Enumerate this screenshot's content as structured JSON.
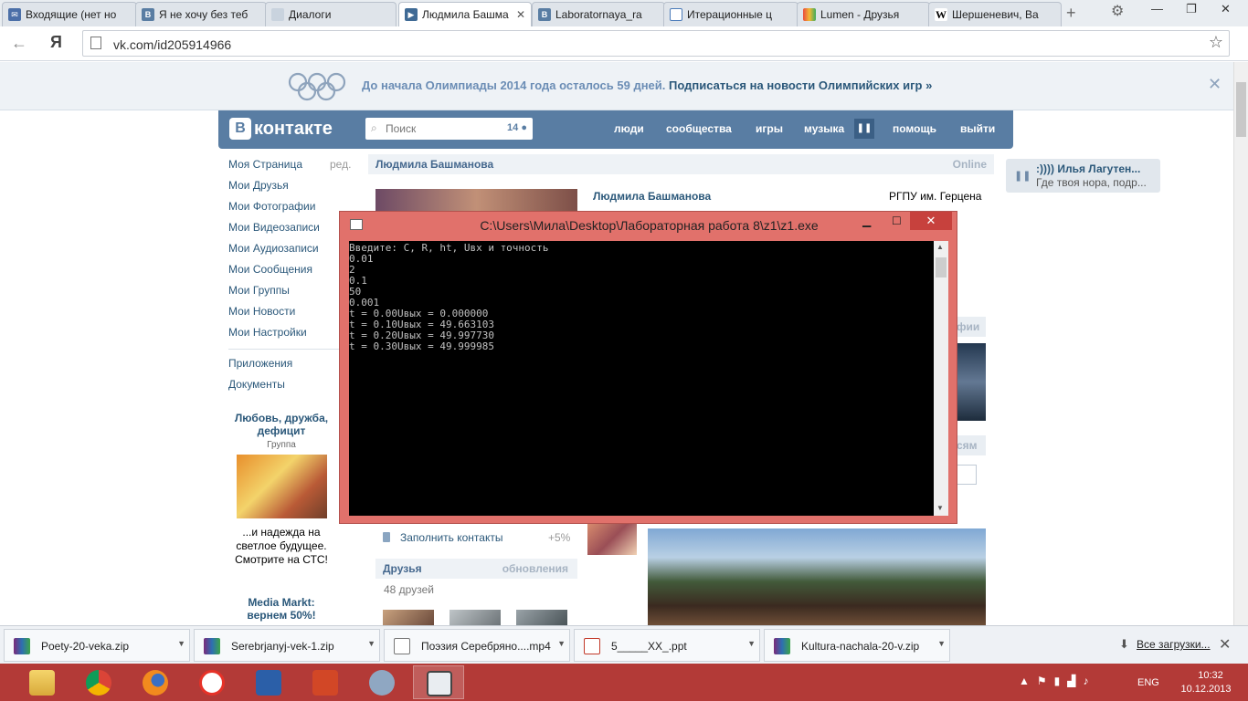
{
  "browser": {
    "tabs": [
      {
        "label": "Входящие (нет но",
        "fav": "mail"
      },
      {
        "label": "Я не хочу без теб",
        "fav": "vk"
      },
      {
        "label": "Диалоги",
        "fav": "doc"
      },
      {
        "label": "Людмила Башма",
        "fav": "vk-play"
      },
      {
        "label": "Laboratornaya_ra",
        "fav": "vk"
      },
      {
        "label": "Итерационные ц",
        "fav": "doc"
      },
      {
        "label": "Lumen - Друзья",
        "fav": "lumen"
      },
      {
        "label": "Шершеневич, Ва",
        "fav": "wiki"
      }
    ],
    "active_tab": 3,
    "address": "vk.com/id205914966",
    "yandex_letter": "Я"
  },
  "banner": {
    "text": "До начала Олимпиады 2014 года осталось 59 дней.",
    "link": "Подписаться на новости Олимпийских игр »"
  },
  "vk": {
    "logo_letter": "B",
    "logo_text": "контакте",
    "search_placeholder": "Поиск",
    "search_count": "14",
    "nav": [
      "люди",
      "сообщества",
      "игры",
      "музыка",
      "помощь",
      "выйти"
    ],
    "menu": [
      "Моя Страница",
      "Мои Друзья",
      "Мои Фотографии",
      "Мои Видеозаписи",
      "Мои Аудиозаписи",
      "Мои Сообщения",
      "Мои Группы",
      "Мои Новости",
      "Мои Настройки"
    ],
    "menu_edit": "ред.",
    "menu_extra": [
      "Приложения",
      "Документы"
    ],
    "ad1": {
      "title": "Любовь, дружба, дефицит",
      "subtitle": "Группа",
      "text": "...и надежда на светлое будущее. Смотрите на СТС!"
    },
    "ad2": {
      "title": "Media Markt:",
      "text": "вернем 50%!"
    },
    "profile": {
      "header_name": "Людмила Башманова",
      "status": "Online",
      "name": "Людмила Башманова",
      "university": "РГПУ им. Герцена",
      "fill_contacts": "Заполнить контакты",
      "fill_pct": "+5%",
      "friends_title": "Друзья",
      "friends_updates": "обновления",
      "friends_count": "48 друзей",
      "right_label_1": "фии",
      "right_label_2": "сям"
    },
    "notification": {
      "title": ":)))) Илья Лагутен...",
      "text": "Где твоя нора, подр..."
    }
  },
  "console": {
    "title": "C:\\Users\\Мила\\Desktop\\Лабораторная работа 8\\z1\\z1.exe",
    "lines": [
      "Введите: C, R, ht, Uвх и точность",
      "0.01",
      "2",
      "0.1",
      "50",
      "0.001",
      "t = 0.00Uвых = 0.000000",
      "t = 0.10Uвых = 49.663103",
      "t = 0.20Uвых = 49.997730",
      "t = 0.30Uвых = 49.999985"
    ]
  },
  "downloads": {
    "items": [
      {
        "label": "Poety-20-veka.zip",
        "type": "zip"
      },
      {
        "label": "Serebrjanyj-vek-1.zip",
        "type": "zip"
      },
      {
        "label": "Поэзия Серебряно....mp4",
        "type": "mp4"
      },
      {
        "label": "5_____XX_.ppt",
        "type": "ppt"
      },
      {
        "label": "Kultura-nachala-20-v.zip",
        "type": "zip"
      }
    ],
    "all_label": "Все загрузки..."
  },
  "taskbar": {
    "apps": [
      "explorer",
      "chrome",
      "firefox",
      "yandex",
      "word",
      "powerpoint",
      "settings",
      "console"
    ],
    "lang": "ENG",
    "time": "10:32",
    "date": "10.12.2013"
  },
  "colors": {
    "vk_blue": "#597da3",
    "taskbar": "#b33a37",
    "console_frame": "#e1716b"
  }
}
